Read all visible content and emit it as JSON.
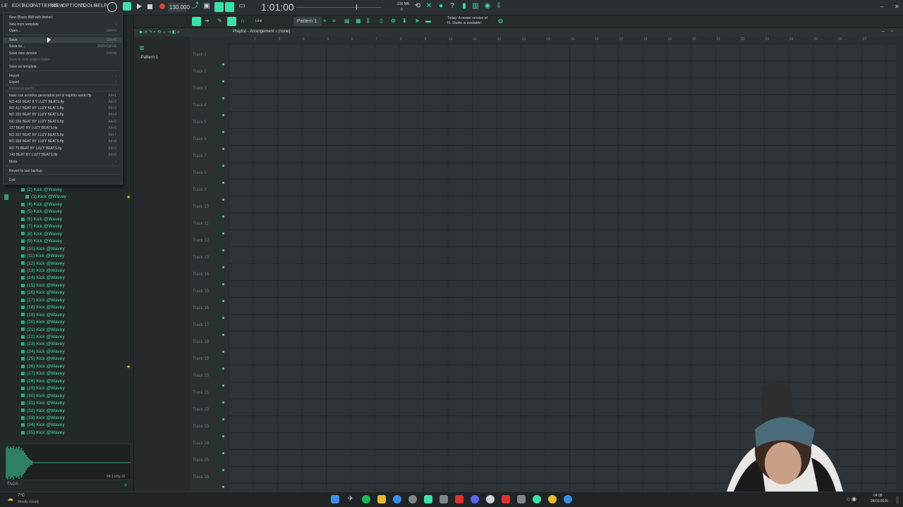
{
  "menubar": {
    "items": [
      "LE",
      "EDIT",
      "ADD",
      "PATTERNS",
      "VIEW",
      "OPTIONS",
      "TOOLS",
      "HELP"
    ]
  },
  "transport": {
    "tempo": "130.000",
    "time": "1:01:00",
    "cpu_mem": "236 MB",
    "cpu_count": "0",
    "pattern_name": "Pattern 1",
    "snap": "Line",
    "notice_line1": "Today: A newer version of",
    "notice_line2": "FL Studio is available!"
  },
  "file_menu": {
    "items": [
      {
        "label": "New (Basic 808 with limiter)",
        "shortcut": "",
        "dim": false
      },
      {
        "label": "New from template",
        "shortcut": "›",
        "dim": false
      },
      {
        "label": "Open...",
        "shortcut": "Ctrl+O",
        "dim": false
      },
      {
        "label": "Save",
        "shortcut": "Ctrl+S",
        "dim": false
      },
      {
        "label": "Save as...",
        "shortcut": "Shift+Ctrl+S",
        "dim": false
      },
      {
        "label": "Save new version",
        "shortcut": "Ctrl+N",
        "dim": false
      },
      {
        "label": "Save to new project folder",
        "shortcut": "",
        "dim": true
      },
      {
        "label": "Save as template...",
        "shortcut": "",
        "dim": false
      },
      {
        "label": "Import",
        "shortcut": "›",
        "dim": false
      },
      {
        "label": "Export",
        "shortcut": "›",
        "dim": false
      },
      {
        "label": "Recent projects",
        "shortcut": "",
        "dim": true
      },
      {
        "label": "base con acordes generados por el espíritu santo.flp",
        "shortcut": "Alt+1",
        "dim": false
      },
      {
        "label": "NO 418 BEAT 8 Y LUZY BEATS.flp",
        "shortcut": "Alt+2",
        "dim": false
      },
      {
        "label": "NO 417 BEAT BY LUZY BEATS.flp",
        "shortcut": "Alt+3",
        "dim": false
      },
      {
        "label": "NO 335 BEAT BY LUZY BEATS.flp",
        "shortcut": "Alt+4",
        "dim": false
      },
      {
        "label": "NO 336 BEAT BY LUZY BEATS.flp",
        "shortcut": "Alt+5",
        "dim": false
      },
      {
        "label": "137 BEAT BY LUZY BEATS.flp",
        "shortcut": "Alt+6",
        "dim": false
      },
      {
        "label": "NO 337 BEAT BY LUZY BEATS.flp",
        "shortcut": "Alt+7",
        "dim": false
      },
      {
        "label": "NO 338 BEAT BY LUZY BEATS.flp",
        "shortcut": "Alt+8",
        "dim": false
      },
      {
        "label": "NO 79 BEAT BY LUZY BEATS.flp",
        "shortcut": "Alt+9",
        "dim": false
      },
      {
        "label": "140 BEAT BY LUZY BEATS.flp",
        "shortcut": "Alt+0",
        "dim": false
      },
      {
        "label": "More",
        "shortcut": "›",
        "dim": false
      },
      {
        "label": "Revert to last backup",
        "shortcut": "",
        "dim": false
      },
      {
        "label": "Exit",
        "shortcut": "",
        "dim": false
      }
    ]
  },
  "browser": {
    "files": [
      "(2) Kick @Wavey",
      "(3) Kick @Wavey",
      "(4) Kick @Wavey",
      "(5) Kick @Wavey",
      "(6) Kick @Wavey",
      "(7) Kick @Wavey",
      "(8) Kick @Wavey",
      "(9) Kick @Wavey",
      "(10) Kick @Wavey",
      "(11) Kick @Wavey",
      "(12) Kick @Wavey",
      "(13) Kick @Wavey",
      "(14) Kick @Wavey",
      "(15) Kick @Wavey",
      "(16) Kick @Wavey",
      "(17) Kick @Wavey",
      "(18) Kick @Wavey",
      "(19) Kick @Wavey",
      "(20) Kick @Wavey",
      "(21) Kick @Wavey",
      "(22) Kick @Wavey",
      "(23) Kick @Wavey",
      "(24) Kick @Wavey",
      "(25) Kick @Wavey",
      "(26) Kick @Wavey",
      "(27) Kick @Wavey",
      "(28) Kick @Wavey",
      "(29) Kick @Wavey",
      "(30) Kick @Wavey",
      "(31) Kick @Wavey",
      "(32) Kick @Wavey",
      "(33) Kick @Wavey",
      "(34) Kick @Wavey",
      "(35) Kick @Wavey"
    ],
    "tags_label": "TAGS",
    "sample_info": "44.1 kHz 32"
  },
  "playlist": {
    "title": "Playlist - Arrangement › (none)",
    "pattern_item": "Pattern 1",
    "tracks": [
      "Track 1",
      "Track 2",
      "Track 3",
      "Track 4",
      "Track 5",
      "Track 6",
      "Track 7",
      "Track 8",
      "Track 9",
      "Track 10",
      "Track 11",
      "Track 12",
      "Track 13",
      "Track 14",
      "Track 15",
      "Track 16",
      "Track 17",
      "Track 18",
      "Track 19",
      "Track 20",
      "Track 21",
      "Track 22",
      "Track 23",
      "Track 24",
      "Track 25",
      "Track 26"
    ],
    "bars": [
      "2",
      "3",
      "4",
      "5",
      "6",
      "7",
      "8",
      "9",
      "10",
      "11",
      "12",
      "13",
      "14",
      "15",
      "16",
      "17",
      "18",
      "19",
      "20",
      "21",
      "22",
      "23",
      "24",
      "25",
      "26",
      "27"
    ]
  },
  "taskbar": {
    "weather_temp": "7°C",
    "weather_desc": "Mostly cloudy",
    "clock_time": "04:08",
    "clock_date": "28/02/2026"
  },
  "colors": {
    "accent": "#3de0a8",
    "background": "#1f2326",
    "menu_bg": "#2b3034"
  }
}
